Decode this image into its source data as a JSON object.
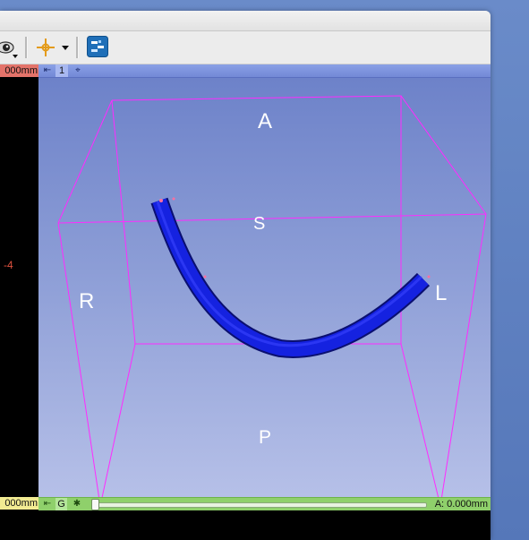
{
  "window": {
    "toolbar": {
      "icons": [
        "eye-view-icon",
        "crosshair-icon",
        "chevron-down-icon",
        "module-extension-icon"
      ]
    }
  },
  "left_panel": {
    "red_bar_value": "000mm",
    "ruler_value": "-4",
    "yellow_bar_value": "000mm"
  },
  "view3d": {
    "view_number": "1",
    "orientation": {
      "anterior": "A",
      "superior": "S",
      "right": "R",
      "left": "L",
      "posterior": "P"
    },
    "slice_bar": {
      "link_label": "G",
      "offset_value": "A: 0.000mm",
      "slider_fraction": 0.0
    },
    "colors": {
      "bounding_box": "#ff2bff",
      "curve": "#1522e0",
      "background_top": "#6d82c9",
      "background_bottom": "#b6c0e8"
    }
  }
}
